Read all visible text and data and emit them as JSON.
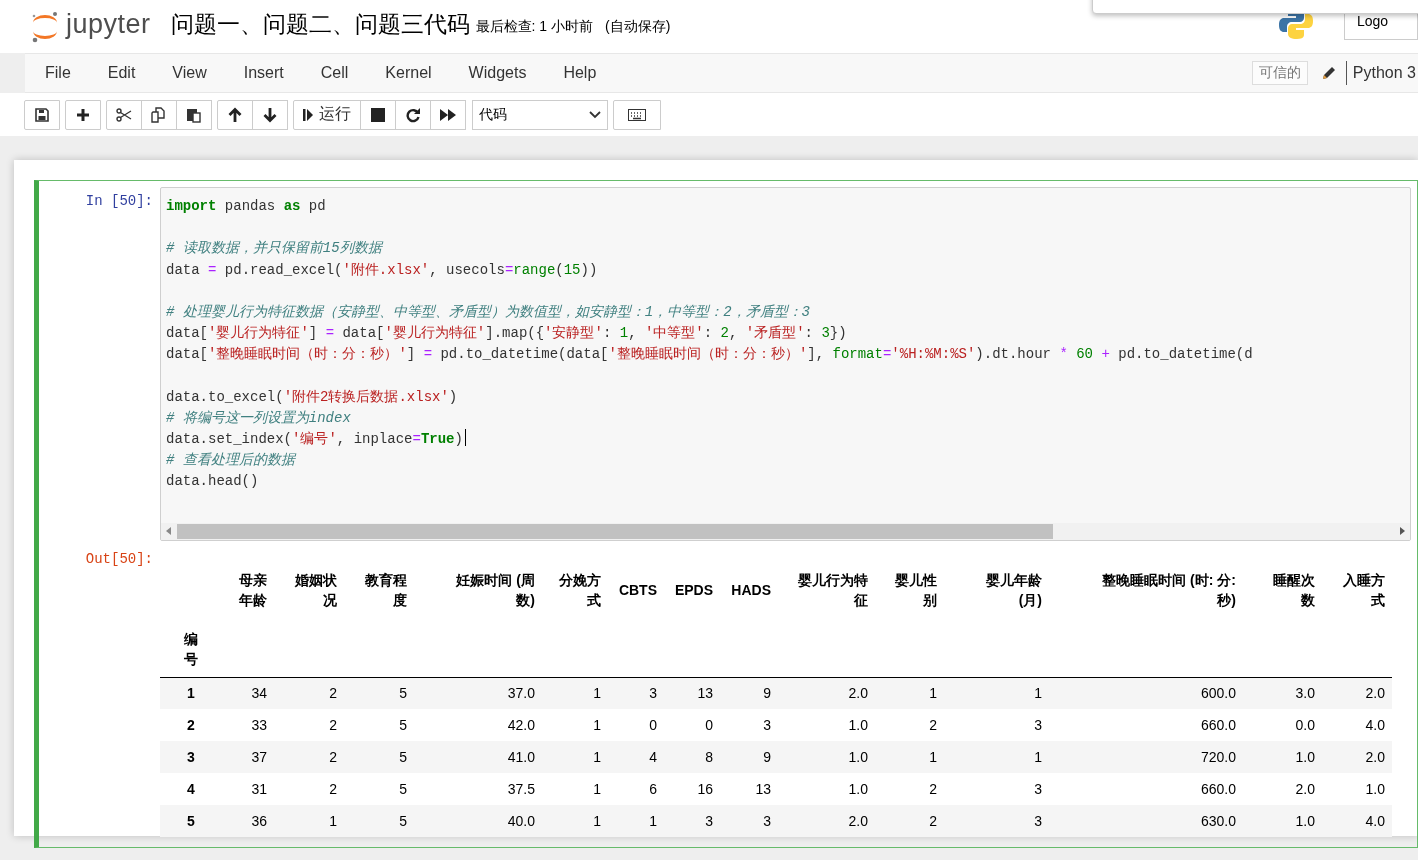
{
  "header": {
    "logo_text": "jupyter",
    "notebook_title": "问题一、问题二、问题三代码",
    "checkpoint": "最后检查: 1 小时前",
    "autosave": "(自动保存)",
    "logout_button": "Logo"
  },
  "menu": {
    "items": [
      "File",
      "Edit",
      "View",
      "Insert",
      "Cell",
      "Kernel",
      "Widgets",
      "Help"
    ],
    "trusted_badge": "可信的",
    "kernel_name": "Python 3"
  },
  "toolbar": {
    "run_label": "运行",
    "cell_type": "代码"
  },
  "cell": {
    "selected": true,
    "input_prompt": "In [50]:",
    "output_prompt": "Out[50]:",
    "code_lines": [
      {
        "kind": "code",
        "cursor": false,
        "tokens": [
          {
            "kind": "kw",
            "text": "import"
          },
          {
            "kind": "plain",
            "text": " pandas "
          },
          {
            "kind": "kw",
            "text": "as"
          },
          {
            "kind": "plain",
            "text": " pd"
          }
        ]
      },
      {
        "kind": "blank"
      },
      {
        "kind": "code",
        "cursor": false,
        "tokens": [
          {
            "kind": "comment",
            "text": "# 读取数据，并只保留前15列数据"
          }
        ]
      },
      {
        "kind": "code",
        "cursor": false,
        "tokens": [
          {
            "kind": "plain",
            "text": "data "
          },
          {
            "kind": "op",
            "text": "="
          },
          {
            "kind": "plain",
            "text": " pd.read_excel("
          },
          {
            "kind": "str",
            "text": "'附件.xlsx'"
          },
          {
            "kind": "plain",
            "text": ", usecols"
          },
          {
            "kind": "op",
            "text": "="
          },
          {
            "kind": "builtin",
            "text": "range"
          },
          {
            "kind": "plain",
            "text": "("
          },
          {
            "kind": "num",
            "text": "15"
          },
          {
            "kind": "plain",
            "text": "))"
          }
        ]
      },
      {
        "kind": "blank"
      },
      {
        "kind": "code",
        "cursor": false,
        "tokens": [
          {
            "kind": "comment",
            "text": "# 处理婴儿行为特征数据（安静型、中等型、矛盾型）为数值型，如安静型：1，中等型：2，矛盾型：3"
          }
        ]
      },
      {
        "kind": "code",
        "cursor": false,
        "tokens": [
          {
            "kind": "plain",
            "text": "data["
          },
          {
            "kind": "str",
            "text": "'婴儿行为特征'"
          },
          {
            "kind": "plain",
            "text": "] "
          },
          {
            "kind": "op",
            "text": "="
          },
          {
            "kind": "plain",
            "text": " data["
          },
          {
            "kind": "str",
            "text": "'婴儿行为特征'"
          },
          {
            "kind": "plain",
            "text": "].map({"
          },
          {
            "kind": "str",
            "text": "'安静型'"
          },
          {
            "kind": "plain",
            "text": ": "
          },
          {
            "kind": "num",
            "text": "1"
          },
          {
            "kind": "plain",
            "text": ", "
          },
          {
            "kind": "str",
            "text": "'中等型'"
          },
          {
            "kind": "plain",
            "text": ": "
          },
          {
            "kind": "num",
            "text": "2"
          },
          {
            "kind": "plain",
            "text": ", "
          },
          {
            "kind": "str",
            "text": "'矛盾型'"
          },
          {
            "kind": "plain",
            "text": ": "
          },
          {
            "kind": "num",
            "text": "3"
          },
          {
            "kind": "plain",
            "text": "})"
          }
        ]
      },
      {
        "kind": "code",
        "cursor": false,
        "tokens": [
          {
            "kind": "plain",
            "text": "data["
          },
          {
            "kind": "str",
            "text": "'整晚睡眠时间（时：分：秒）'"
          },
          {
            "kind": "plain",
            "text": "] "
          },
          {
            "kind": "op",
            "text": "="
          },
          {
            "kind": "plain",
            "text": " pd.to_datetime(data["
          },
          {
            "kind": "str",
            "text": "'整晚睡眠时间（时：分：秒）'"
          },
          {
            "kind": "plain",
            "text": "], "
          },
          {
            "kind": "builtin",
            "text": "format"
          },
          {
            "kind": "op",
            "text": "="
          },
          {
            "kind": "str",
            "text": "'%H:%M:%S'"
          },
          {
            "kind": "plain",
            "text": ").dt.hour"
          },
          {
            "kind": "op",
            "text": " * "
          },
          {
            "kind": "num",
            "text": "60"
          },
          {
            "kind": "op",
            "text": " + "
          },
          {
            "kind": "plain",
            "text": "pd.to_datetime(d"
          }
        ]
      },
      {
        "kind": "blank"
      },
      {
        "kind": "code",
        "cursor": false,
        "tokens": [
          {
            "kind": "plain",
            "text": "data.to_excel("
          },
          {
            "kind": "str",
            "text": "'附件2转换后数据.xlsx'"
          },
          {
            "kind": "plain",
            "text": ")"
          }
        ]
      },
      {
        "kind": "code",
        "cursor": false,
        "tokens": [
          {
            "kind": "comment",
            "text": "# 将编号这一列设置为index"
          }
        ]
      },
      {
        "kind": "code",
        "cursor": true,
        "tokens": [
          {
            "kind": "plain",
            "text": "data.set_index("
          },
          {
            "kind": "str",
            "text": "'编号'"
          },
          {
            "kind": "plain",
            "text": ", inplace"
          },
          {
            "kind": "op",
            "text": "="
          },
          {
            "kind": "kw",
            "text": "True"
          },
          {
            "kind": "plain",
            "text": ")"
          }
        ]
      },
      {
        "kind": "code",
        "cursor": false,
        "tokens": [
          {
            "kind": "comment",
            "text": "# 查看处理后的数据"
          }
        ]
      },
      {
        "kind": "code",
        "cursor": false,
        "tokens": [
          {
            "kind": "plain",
            "text": "data.head()"
          }
        ]
      }
    ]
  },
  "table": {
    "columns": [
      "母亲年龄",
      "婚姻状况",
      "教育程度",
      "妊娠时间 (周数)",
      "分娩方式",
      "CBTS",
      "EPDS",
      "HADS",
      "婴儿行为特征",
      "婴儿性别",
      "婴儿年龄(月)",
      "整晚睡眠时间 (时: 分: 秒)",
      "睡醒次数",
      "入睡方式"
    ],
    "index_name": "编号",
    "rows": [
      {
        "index": "1",
        "values": [
          "34",
          "2",
          "5",
          "37.0",
          "1",
          "3",
          "13",
          "9",
          "2.0",
          "1",
          "1",
          "600.0",
          "3.0",
          "2.0"
        ]
      },
      {
        "index": "2",
        "values": [
          "33",
          "2",
          "5",
          "42.0",
          "1",
          "0",
          "0",
          "3",
          "1.0",
          "2",
          "3",
          "660.0",
          "0.0",
          "4.0"
        ]
      },
      {
        "index": "3",
        "values": [
          "37",
          "2",
          "5",
          "41.0",
          "1",
          "4",
          "8",
          "9",
          "1.0",
          "1",
          "1",
          "720.0",
          "1.0",
          "2.0"
        ]
      },
      {
        "index": "4",
        "values": [
          "31",
          "2",
          "5",
          "37.5",
          "1",
          "6",
          "16",
          "13",
          "1.0",
          "2",
          "3",
          "660.0",
          "2.0",
          "1.0"
        ]
      },
      {
        "index": "5",
        "values": [
          "36",
          "1",
          "5",
          "40.0",
          "1",
          "1",
          "3",
          "3",
          "2.0",
          "2",
          "3",
          "630.0",
          "1.0",
          "4.0"
        ]
      }
    ]
  }
}
